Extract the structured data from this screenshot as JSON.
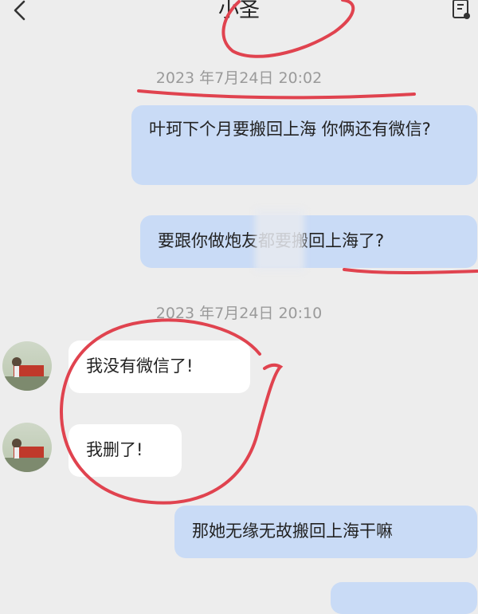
{
  "header": {
    "title": "小圣",
    "back_icon": "chevron-left-icon",
    "menu_icon": "contact-card-icon"
  },
  "messages": [
    {
      "type": "timestamp",
      "text": "2023 年7月24日 20:02"
    },
    {
      "type": "outgoing",
      "text": "叶珂下个月要搬回上海 你俩还有微信?"
    },
    {
      "type": "outgoing",
      "text": "要跟你做炮友都要搬回上海了?"
    },
    {
      "type": "timestamp",
      "text": "2023 年7月24日 20:10"
    },
    {
      "type": "incoming",
      "text": "我没有微信了!"
    },
    {
      "type": "incoming",
      "text": "我删了!"
    },
    {
      "type": "outgoing",
      "text": "那她无缘无故搬回上海干嘛"
    }
  ],
  "colors": {
    "outgoing_bubble": "#c9dbf6",
    "incoming_bubble": "#ffffff",
    "background": "#ededed",
    "annotation": "#e0434f"
  }
}
